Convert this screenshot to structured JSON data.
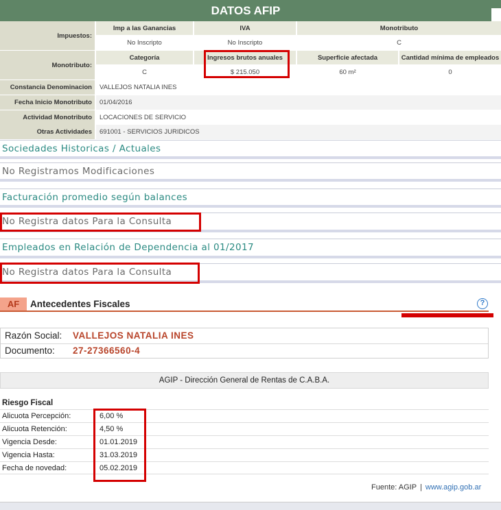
{
  "afip": {
    "title": "DATOS AFIP",
    "impuestos_label": "Impuestos:",
    "tax_headers": [
      "Imp a las Ganancias",
      "IVA",
      "Monotributo"
    ],
    "tax_values": [
      "No Inscripto",
      "No Inscripto",
      "C"
    ],
    "monotributo_label": "Monotributo:",
    "mono_headers": [
      "Categoría",
      "Ingresos brutos anuales",
      "Superficie afectada",
      "Cantidad mínima de empleados"
    ],
    "mono_values": [
      "C",
      "$ 215.050",
      "60 m²",
      "0"
    ],
    "rows": [
      {
        "label": "Constancia Denominacion",
        "value": "VALLEJOS NATALIA INES"
      },
      {
        "label": "Fecha Inicio Monotributo",
        "value": "01/04/2016"
      },
      {
        "label": "Actividad Monotributo",
        "value": "LOCACIONES DE SERVICIO"
      },
      {
        "label": "Otras Actividades",
        "value": "691001 - SERVICIOS JURIDICOS"
      }
    ]
  },
  "sections": {
    "sociedades_title": "Sociedades Historicas / Actuales",
    "sociedades_value": "No Registramos Modificaciones",
    "facturacion_title": "Facturación promedio según balances",
    "facturacion_value": "No Registra datos Para la Consulta",
    "empleados_title": "Empleados en Relación de Dependencia al 01/2017",
    "empleados_value": "No Registra datos Para la Consulta"
  },
  "antecedentes": {
    "badge": "AF",
    "title": "Antecedentes Fiscales",
    "help": "?",
    "razon_label": "Razón Social:",
    "razon_value": "VALLEJOS NATALIA INES",
    "documento_label": "Documento:",
    "documento_value": "27-27366560-4",
    "agip_title": "AGIP - Dirección General de Rentas de C.A.B.A.",
    "riesgo_title": "Riesgo Fiscal",
    "riesgo_rows": [
      {
        "label": "Alicuota Percepción:",
        "value": "6,00 %"
      },
      {
        "label": "Alicuota Retención:",
        "value": "4,50 %"
      },
      {
        "label": "Vigencia Desde:",
        "value": "01.01.2019"
      },
      {
        "label": "Vigencia Hasta:",
        "value": "31.03.2019"
      },
      {
        "label": "Fecha de novedad:",
        "value": "05.02.2019"
      }
    ],
    "fuente_label": "Fuente: AGIP",
    "fuente_sep": "|",
    "fuente_link": "www.agip.gob.ar"
  },
  "colors": {
    "header_green": "#5f8566",
    "teal_text": "#2a8a82",
    "highlight_red": "#d40000",
    "value_red": "#b8442a"
  }
}
